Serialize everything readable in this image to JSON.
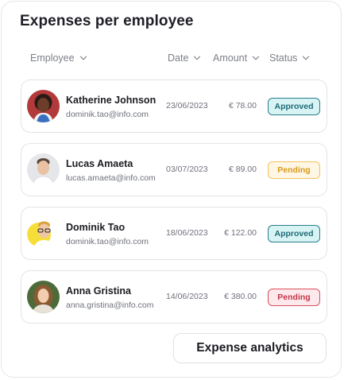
{
  "card": {
    "title": "Expenses per employee"
  },
  "table": {
    "headers": {
      "employee": "Employee",
      "date": "Date",
      "amount": "Amount",
      "status": "Status"
    },
    "rows": [
      {
        "name": "Katherine Johnson",
        "email": "dominik.tao@info.com",
        "date": "23/06/2023",
        "amount": "€ 78.00",
        "status": "Approved",
        "status_color": "#1d6b77"
      },
      {
        "name": "Lucas Amaeta",
        "email": "lucas.amaeta@info.com",
        "date": "03/07/2023",
        "amount": "€ 89.00",
        "status": "Pending",
        "status_color": "#d79a17"
      },
      {
        "name": "Dominik Tao",
        "email": "dominik.tao@info.com",
        "date": "18/06/2023",
        "amount": "€ 122.00",
        "status": "Approved",
        "status_color": "#1d6b77"
      },
      {
        "name": "Anna Gristina",
        "email": "anna.gristina@info.com",
        "date": "14/06/2023",
        "amount": "€ 380.00",
        "status": "Pending",
        "status_color": "#c43447"
      }
    ]
  },
  "actions": {
    "analytics_label": "Expense analytics"
  },
  "icons": {
    "header_sort": "chevron-down-icon",
    "avatar": "avatar-photo"
  }
}
